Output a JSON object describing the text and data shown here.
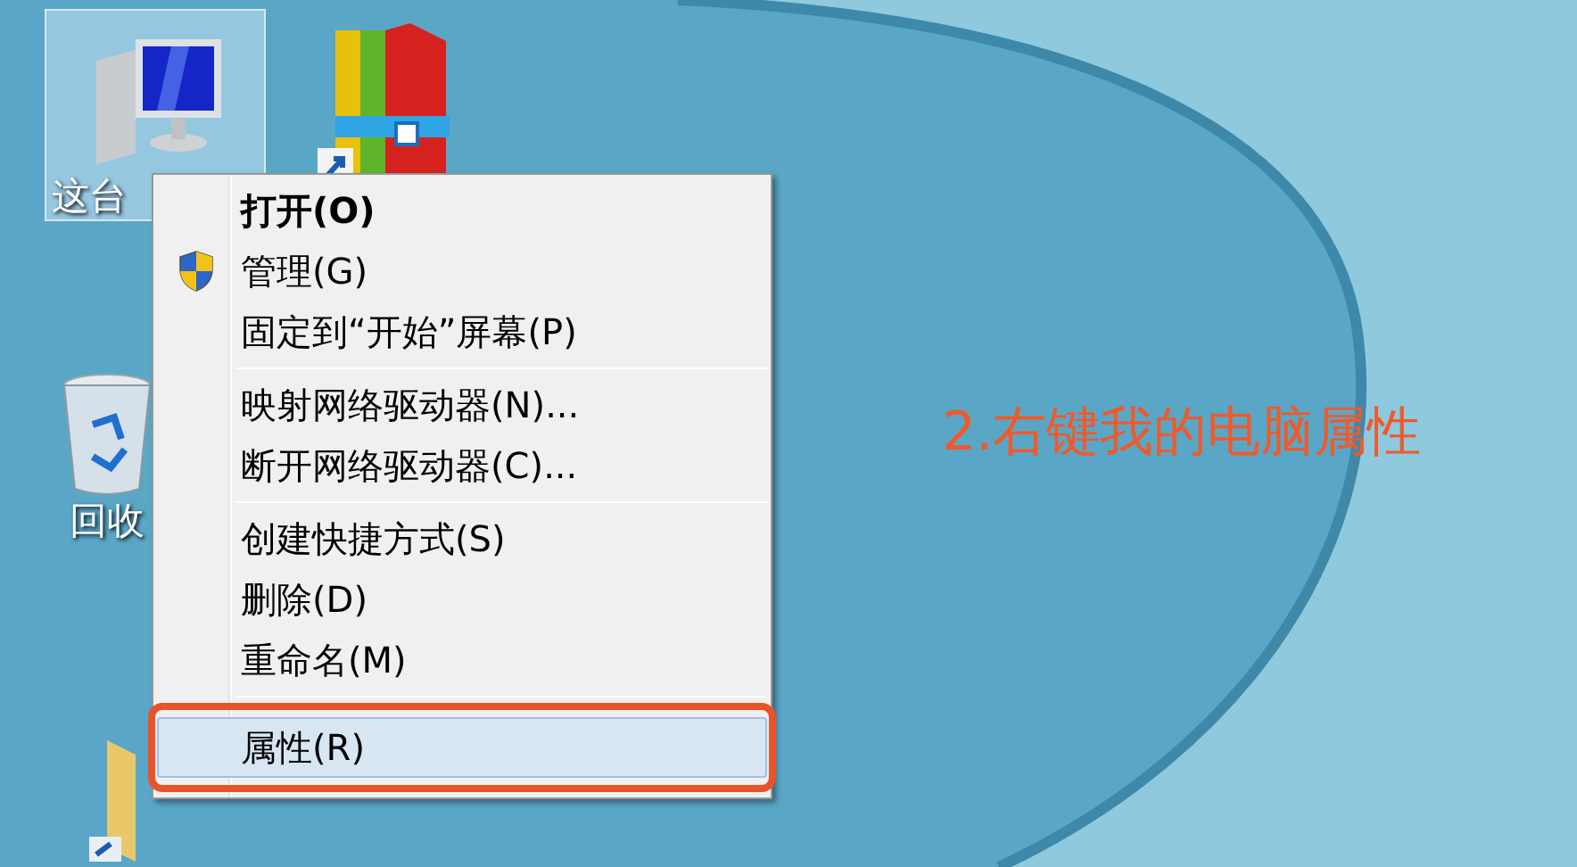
{
  "desktop_icons": [
    {
      "kind": "computer",
      "label": "这台",
      "selected": true
    },
    {
      "kind": "archive",
      "selected": false
    },
    {
      "kind": "recycle-bin",
      "label": "回收",
      "selected": false
    },
    {
      "kind": "folder",
      "selected": false
    }
  ],
  "context_menu": {
    "items": [
      {
        "kind": "item",
        "label": "打开(O)",
        "bold": true,
        "shield": false,
        "selected": false,
        "annotated": false
      },
      {
        "kind": "item",
        "label": "管理(G)",
        "bold": false,
        "shield": true,
        "selected": false,
        "annotated": false
      },
      {
        "kind": "item",
        "label": "固定到“开始”屏幕(P)",
        "bold": false,
        "shield": false,
        "selected": false,
        "annotated": false
      },
      {
        "kind": "separator"
      },
      {
        "kind": "item",
        "label": "映射网络驱动器(N)...",
        "bold": false,
        "shield": false,
        "selected": false,
        "annotated": false
      },
      {
        "kind": "item",
        "label": "断开网络驱动器(C)...",
        "bold": false,
        "shield": false,
        "selected": false,
        "annotated": false
      },
      {
        "kind": "separator"
      },
      {
        "kind": "item",
        "label": "创建快捷方式(S)",
        "bold": false,
        "shield": false,
        "selected": false,
        "annotated": false
      },
      {
        "kind": "item",
        "label": "删除(D)",
        "bold": false,
        "shield": false,
        "selected": false,
        "annotated": false
      },
      {
        "kind": "item",
        "label": "重命名(M)",
        "bold": false,
        "shield": false,
        "selected": false,
        "annotated": false
      },
      {
        "kind": "separator"
      },
      {
        "kind": "item",
        "label": "属性(R)",
        "bold": false,
        "shield": false,
        "selected": true,
        "annotated": true
      }
    ]
  },
  "annotation": {
    "text": "2.右键我的电脑属性"
  }
}
